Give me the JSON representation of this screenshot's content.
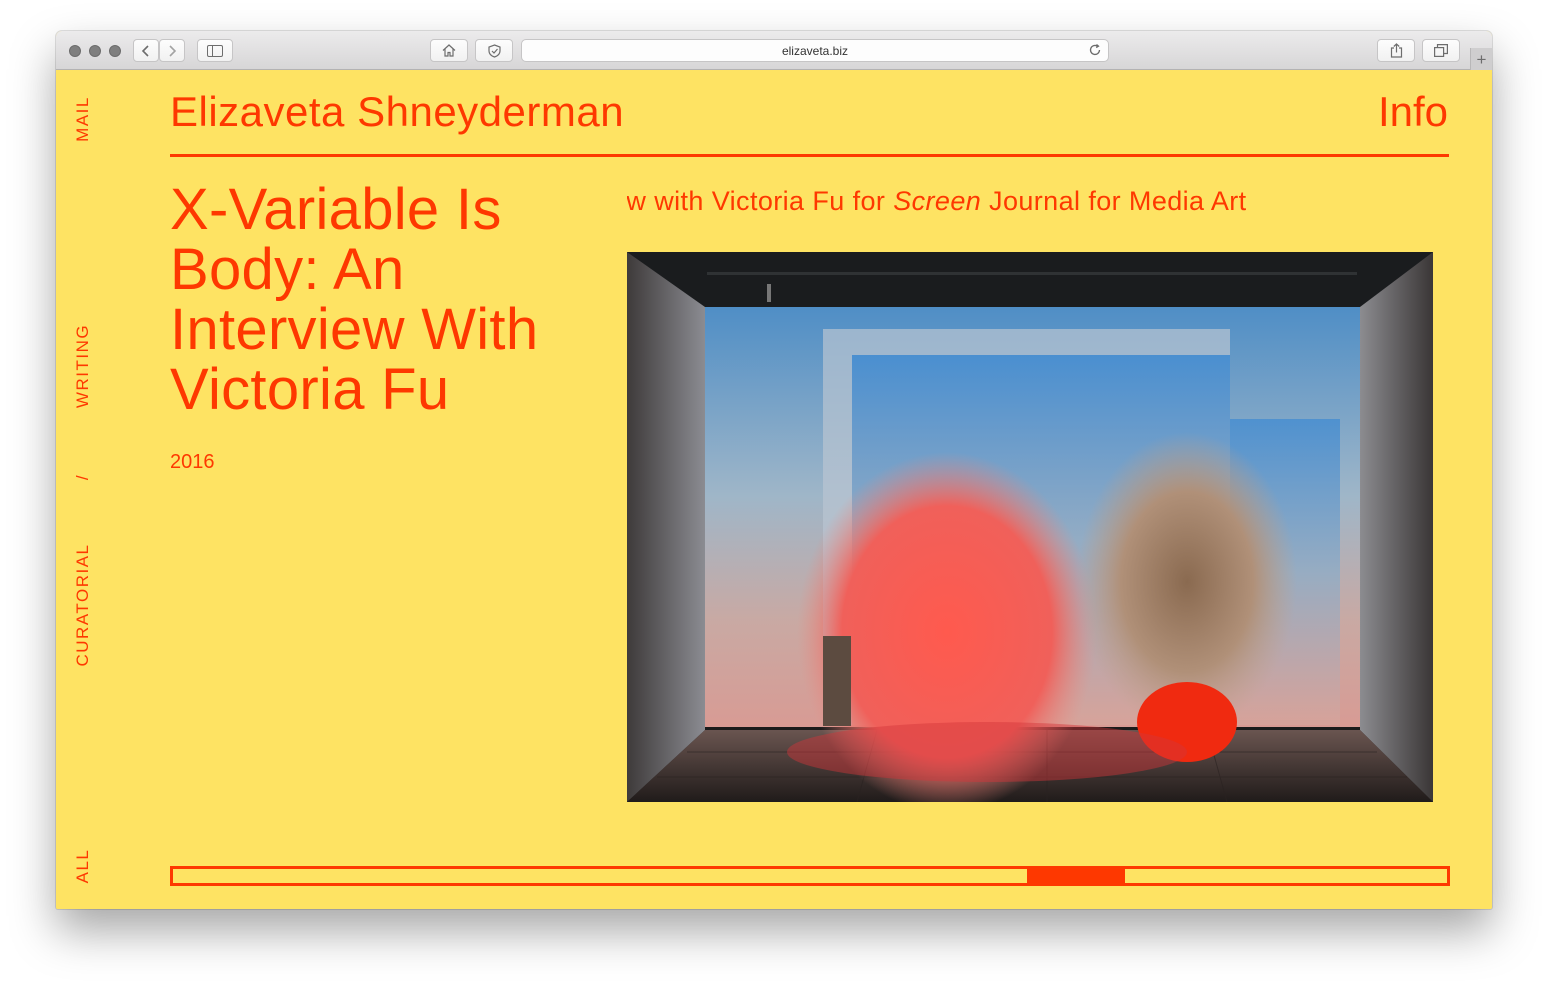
{
  "browser": {
    "url": "elizaveta.biz"
  },
  "nav": {
    "mail": "MAIL",
    "writing": "WRITING",
    "separator": "/",
    "curatorial": "CURATORIAL",
    "all": "ALL"
  },
  "header": {
    "site_title": "Elizaveta Shneyderman",
    "info": "Info"
  },
  "article": {
    "title": "X-Variable Is Body: An Interview With Victoria Fu",
    "year": "2016",
    "marquee_before": "ew with Victoria Fu for ",
    "marquee_italic": "Screen",
    "marquee_after": " Journal for Media Art"
  },
  "slider": {
    "position_fraction": 0.67,
    "thumb_fraction": 0.077
  },
  "colors": {
    "background": "#fee363",
    "accent": "#fe3800"
  }
}
